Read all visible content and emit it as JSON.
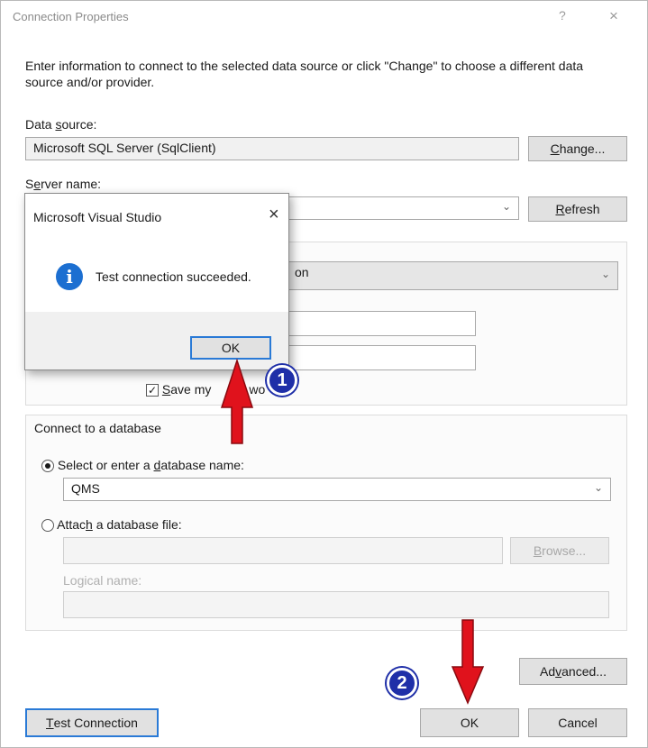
{
  "window": {
    "title": "Connection Properties",
    "help_glyph": "?",
    "close_glyph": "×"
  },
  "intro_text": "Enter information to connect to the selected data source or click \"Change\" to choose a different data source and/or provider.",
  "data_source": {
    "label_pre": "Data ",
    "label_key": "s",
    "label_post": "ource:",
    "value": "Microsoft SQL Server (SqlClient)",
    "change_pre": "",
    "change_key": "C",
    "change_post": "hange..."
  },
  "server_name": {
    "label_pre": "S",
    "label_key": "e",
    "label_post": "rver name:",
    "refresh_pre": "",
    "refresh_key": "R",
    "refresh_post": "efresh"
  },
  "auth_partial": {
    "dropdown_fragment": "on",
    "save_pw_pre": "",
    "save_pw_key": "S",
    "save_pw_post": "ave my",
    "save_pw_fragment": "wo"
  },
  "connect_db": {
    "group_title": "Connect to a database",
    "select_pre": "Select or enter a ",
    "select_key": "d",
    "select_post": "atabase name:",
    "db_value": "QMS",
    "attach_pre": "Attac",
    "attach_key": "h",
    "attach_post": " a database file:",
    "browse_pre": "",
    "browse_key": "B",
    "browse_post": "rowse...",
    "logical_name_label": "Logical name:"
  },
  "buttons": {
    "advanced_pre": "Ad",
    "advanced_key": "v",
    "advanced_post": "anced...",
    "test_pre": "",
    "test_key": "T",
    "test_post": "est Connection",
    "ok": "OK",
    "cancel": "Cancel"
  },
  "msgbox": {
    "title": "Microsoft Visual Studio",
    "close_glyph": "×",
    "message": "Test connection succeeded.",
    "icon_glyph": "i",
    "ok": "OK"
  },
  "annotations": {
    "badge_1": "1",
    "badge_2": "2",
    "arrow_color": "#e0121c",
    "badge_color": "#1f2fa8"
  }
}
